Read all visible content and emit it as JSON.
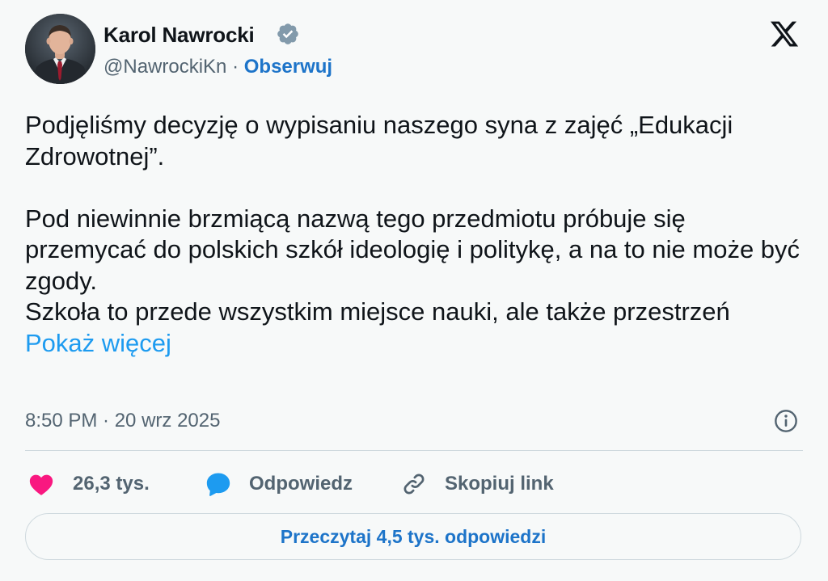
{
  "author": {
    "name": "Karol Nawrocki",
    "handle": "@NawrockiKn",
    "separator": " · ",
    "follow_label": "Obserwuj"
  },
  "tweet": {
    "paragraph_1": "Podjęliśmy decyzję o wypisaniu naszego syna z zajęć „Edukacji Zdrowotnej”.",
    "paragraph_2": "Pod niewinnie brzmiącą nazwą tego przedmiotu próbuje się przemycać do polskich szkół ideologię i politykę, a na to nie może być zgody.",
    "paragraph_3_start": "Szkoła to przede wszystkim miejsce nauki, ale także przestrzeń ",
    "show_more_label": "Pokaż więcej"
  },
  "timestamp": "8:50 PM · 20 wrz 2025",
  "actions": {
    "like_count": "26,3 tys.",
    "reply_label": "Odpowiedz",
    "copy_link_label": "Skopiuj link"
  },
  "read_replies_label": "Przeczytaj 4,5 tys. odpowiedzi",
  "icons": {
    "verified": "verified-badge-icon",
    "logo": "x-logo-icon",
    "info": "info-icon",
    "like": "heart-icon",
    "reply": "speech-bubble-icon",
    "copy": "link-icon"
  },
  "colors": {
    "link_blue": "#1d9bf0",
    "follow_blue": "#1d74c9",
    "like_pink": "#f91880",
    "reply_blue": "#1d9bf0",
    "muted_text": "#536471"
  }
}
